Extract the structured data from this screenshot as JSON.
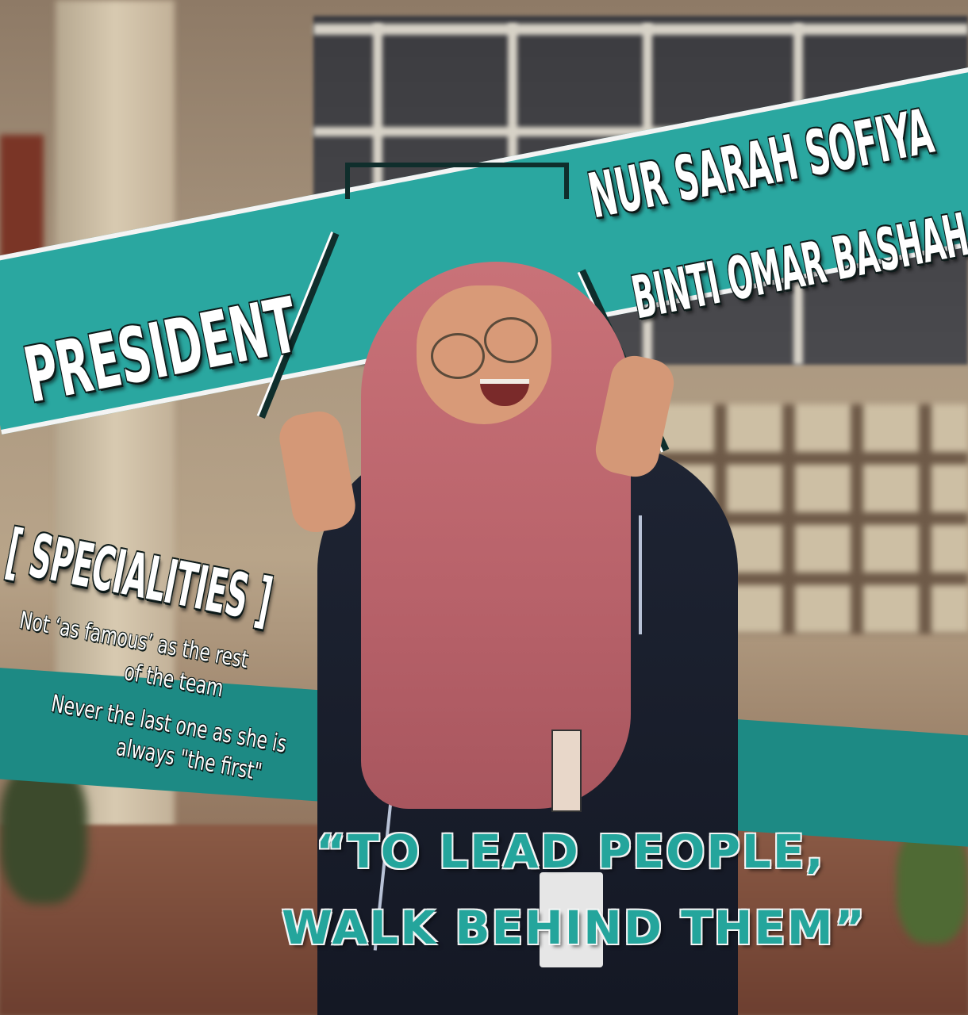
{
  "poster": {
    "role": "PRESIDENT",
    "name_line1": "NUR SARAH SOFIYA",
    "name_line2": "BINTI OMAR BASHAH",
    "specialities_heading": "[ SPECIALITIES ]",
    "specialities_lines": [
      "Not ‘as famous’ as the rest",
      "of the team",
      "Never the last one as she is",
      "always \"the first\""
    ],
    "quote_line1": "“TO LEAD PEOPLE,",
    "quote_line2": "WALK BEHIND THEM”"
  },
  "colors": {
    "accent_teal": "#2aa7a0",
    "text_white": "#ffffff",
    "outline_dark": "#0d1a19"
  }
}
